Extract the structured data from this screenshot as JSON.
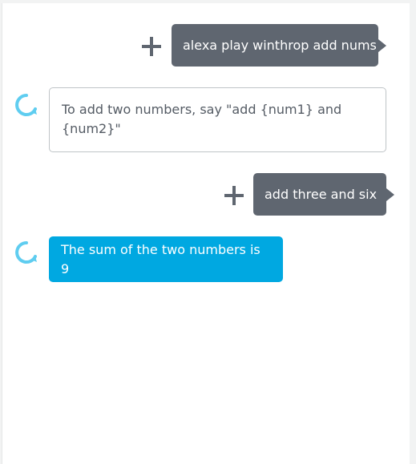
{
  "conversation": [
    {
      "speaker": "user",
      "text": "alexa play winthrop add nums"
    },
    {
      "speaker": "alexa",
      "text": "To add two numbers, say \"add {num1} and {num2}\""
    },
    {
      "speaker": "user",
      "text": "add three and six"
    },
    {
      "speaker": "alexa",
      "text": "The sum of the two numbers is 9"
    }
  ],
  "colors": {
    "user_bubble": "#5f6670",
    "alexa_light_border": "#bfc4c7",
    "alexa_latest_bubble": "#00a8e1",
    "alexa_ring": "#5fcdf0"
  },
  "icons": {
    "add": "plus-icon",
    "alexa": "alexa-ring-icon"
  }
}
